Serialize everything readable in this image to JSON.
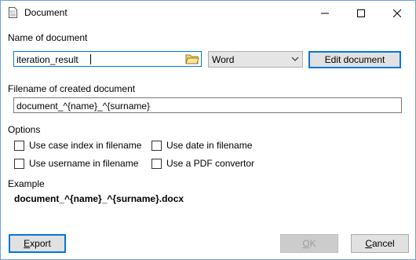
{
  "window": {
    "title": "Document",
    "icon": "document-app-icon",
    "controls": [
      "minimize-icon",
      "maximize-icon",
      "close-icon"
    ]
  },
  "name_section": {
    "label": "Name of document",
    "input_value": "iteration_result",
    "format_value": "Word",
    "edit_button": "Edit document"
  },
  "filename_section": {
    "label": "Filename of created document",
    "input_value": "document_^{name}_^{surname}"
  },
  "options": {
    "label": "Options",
    "items": [
      {
        "label": "Use case index in filename",
        "checked": false
      },
      {
        "label": "Use date in filename",
        "checked": false
      },
      {
        "label": "Use username in filename",
        "checked": false
      },
      {
        "label": "Use a PDF convertor",
        "checked": false
      }
    ]
  },
  "example": {
    "label": "Example",
    "value": "document_^{name}_^{surname}.docx"
  },
  "footer": {
    "export_first": "E",
    "export_rest": "xport",
    "ok_first": "O",
    "ok_rest": "K",
    "cancel_first": "C",
    "cancel_rest": "ancel"
  },
  "colors": {
    "focus_blue": "#0078d7",
    "button_bg": "#e1e1e1",
    "disabled_text": "#9d9d9d"
  }
}
